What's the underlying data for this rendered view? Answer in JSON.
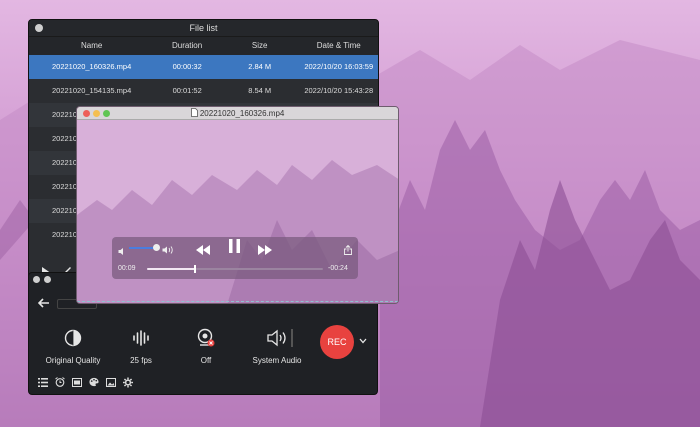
{
  "file_list": {
    "title": "File list",
    "columns": [
      "Name",
      "Duration",
      "Size",
      "Date & Time"
    ],
    "rows": [
      {
        "name": "20221020_160326.mp4",
        "duration": "00:00:32",
        "size": "2.84 M",
        "date": "2022/10/20 16:03:59"
      },
      {
        "name": "20221020_154135.mp4",
        "duration": "00:01:52",
        "size": "8.54 M",
        "date": "2022/10/20 15:43:28"
      },
      {
        "name": "20221020",
        "duration": "",
        "size": "",
        "date": ""
      },
      {
        "name": "20221020",
        "duration": "",
        "size": "",
        "date": ""
      },
      {
        "name": "20221020",
        "duration": "",
        "size": "",
        "date": ""
      },
      {
        "name": "20221020",
        "duration": "",
        "size": "",
        "date": ""
      },
      {
        "name": "20221020",
        "duration": "",
        "size": "",
        "date": ""
      }
    ],
    "tools": [
      "play-icon",
      "brush-icon"
    ]
  },
  "player": {
    "title": "20221020_160326.mp4",
    "elapsed": "00:09",
    "remaining": "-00:24",
    "progress": 0.27,
    "volume": 0.9
  },
  "recorder": {
    "options": [
      {
        "icon": "quality-icon",
        "label": "Original Quality"
      },
      {
        "icon": "waveform-icon",
        "label": "25 fps"
      },
      {
        "icon": "webcam-icon",
        "label": "Off"
      },
      {
        "icon": "speaker-icon",
        "label": "System Audio"
      }
    ],
    "rec_label": "REC",
    "bottom_icons": [
      "list-icon",
      "alarm-icon",
      "film-icon",
      "palette-icon",
      "image-icon",
      "gear-icon"
    ]
  },
  "colors": {
    "selected_row": "#3c77c0",
    "rec_button": "#e8423f",
    "volume_fill": "#4a7de0"
  }
}
